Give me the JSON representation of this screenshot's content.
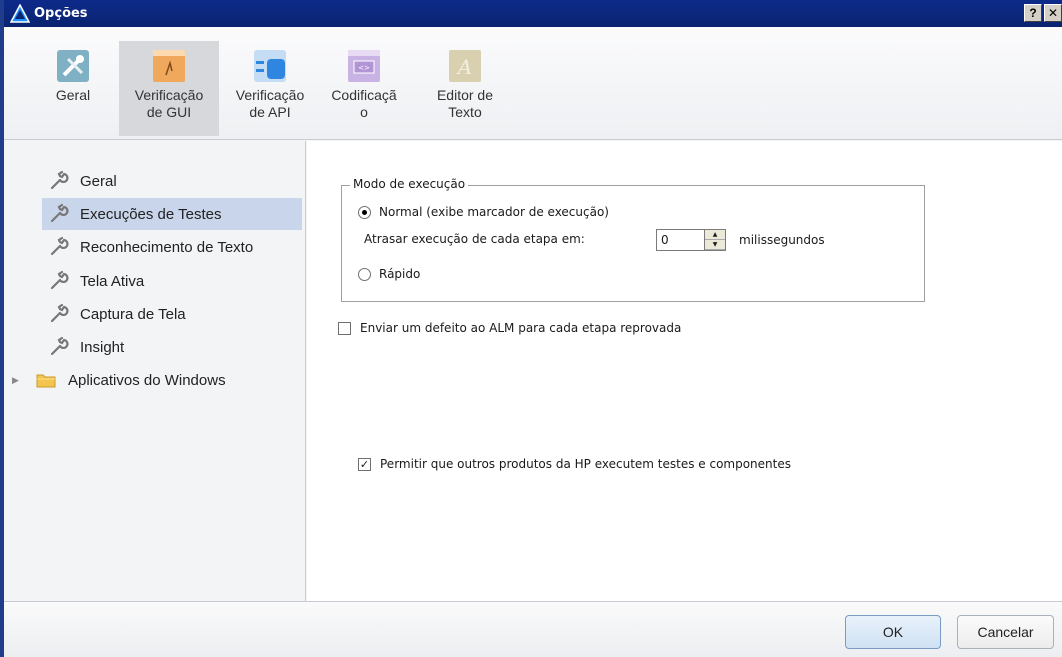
{
  "window": {
    "title": "Opções",
    "help_button": "?",
    "close_button": "✕"
  },
  "toolbar": {
    "tabs": [
      {
        "label_line1": "Geral",
        "label_line2": "",
        "icon": "tools-icon"
      },
      {
        "label_line1": "Verificação",
        "label_line2": "de GUI",
        "icon": "gui-test-icon",
        "selected": true
      },
      {
        "label_line1": "Verificação",
        "label_line2": "de API",
        "icon": "api-test-icon"
      },
      {
        "label_line1": "Codificaçã",
        "label_line2": "o",
        "icon": "coding-icon"
      },
      {
        "label_line1": "Editor de",
        "label_line2": "Texto",
        "icon": "text-editor-icon"
      }
    ]
  },
  "sidebar": {
    "items": [
      {
        "label": "Geral"
      },
      {
        "label": "Execuções de Testes",
        "selected": true
      },
      {
        "label": "Reconhecimento de Texto"
      },
      {
        "label": "Tela Ativa"
      },
      {
        "label": "Captura de Tela"
      },
      {
        "label": "Insight"
      }
    ],
    "folder": {
      "label": "Aplicativos do Windows"
    }
  },
  "run_mode": {
    "group_title": "Modo de execução",
    "normal_label": "Normal (exibe marcador de execução)",
    "normal_selected": true,
    "delay_label": "Atrasar execução de cada etapa em:",
    "delay_value": "0",
    "delay_unit": "milissegundos",
    "fast_label": "Rápido",
    "fast_selected": false
  },
  "options": {
    "send_defect_label": "Enviar um defeito ao ALM para cada etapa reprovada",
    "send_defect_checked": false,
    "allow_hp_label": "Permitir que outros produtos da HP executem testes e componentes",
    "allow_hp_checked": true
  },
  "footer": {
    "ok_label": "OK",
    "cancel_label": "Cancelar"
  },
  "colors": {
    "titlebar": "#0a2470",
    "selection": "#c9d5ea",
    "ok_button": "#cfe1f3"
  }
}
